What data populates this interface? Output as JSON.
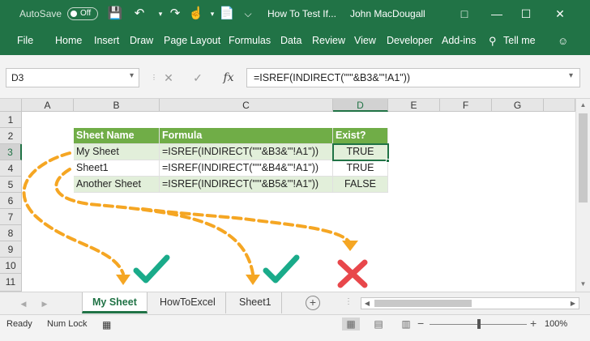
{
  "title_bar": {
    "autosave_label": "AutoSave",
    "autosave_state": "Off",
    "document_title": "How To Test If...",
    "user_name": "John MacDougall"
  },
  "ribbon": {
    "tabs": [
      "File",
      "Home",
      "Insert",
      "Draw",
      "Page Layout",
      "Formulas",
      "Data",
      "Review",
      "View",
      "Developer",
      "Add-ins"
    ],
    "tell_me": "Tell me"
  },
  "formula_bar": {
    "name_box": "D3",
    "formula": "=ISREF(INDIRECT(\"'\"&B3&\"'!A1\"))"
  },
  "columns": [
    "A",
    "B",
    "C",
    "D",
    "E",
    "F",
    "G"
  ],
  "rows": [
    "1",
    "2",
    "3",
    "4",
    "5",
    "6",
    "7",
    "8",
    "9",
    "10",
    "11"
  ],
  "table": {
    "headers": [
      "Sheet Name",
      "Formula",
      "Exist?"
    ],
    "rows": [
      [
        "My Sheet",
        "=ISREF(INDIRECT(\"'\"&B3&\"'!A1\"))",
        "TRUE"
      ],
      [
        "Sheet1",
        "=ISREF(INDIRECT(\"'\"&B4&\"'!A1\"))",
        "TRUE"
      ],
      [
        "Another Sheet",
        "=ISREF(INDIRECT(\"'\"&B5&\"'!A1\"))",
        "FALSE"
      ]
    ]
  },
  "sheet_tabs": [
    "My Sheet",
    "HowToExcel",
    "Sheet1"
  ],
  "status_bar": {
    "ready": "Ready",
    "num_lock": "Num Lock",
    "zoom": "100%"
  },
  "annotation_colors": {
    "arrow": "#f5a623",
    "check": "#1aab8a",
    "cross": "#e8474b"
  }
}
